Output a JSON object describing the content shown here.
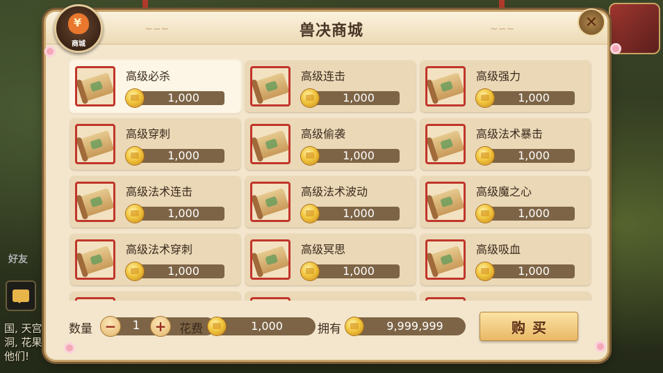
{
  "window": {
    "title": "兽决商城"
  },
  "badge": {
    "label": "商城"
  },
  "close": {
    "glyph": "✕"
  },
  "background": {
    "left_text": [
      "国, 天宫",
      "洞, 花果",
      "他们!"
    ],
    "friend_label": "好友"
  },
  "items": [
    {
      "name": "高级必杀",
      "price": "1,000",
      "selected": true
    },
    {
      "name": "高级连击",
      "price": "1,000"
    },
    {
      "name": "高级强力",
      "price": "1,000"
    },
    {
      "name": "高级穿刺",
      "price": "1,000"
    },
    {
      "name": "高级偷袭",
      "price": "1,000"
    },
    {
      "name": "高级法术暴击",
      "price": "1,000"
    },
    {
      "name": "高级法术连击",
      "price": "1,000"
    },
    {
      "name": "高级法术波动",
      "price": "1,000"
    },
    {
      "name": "高级魔之心",
      "price": "1,000"
    },
    {
      "name": "高级法术穿刺",
      "price": "1,000"
    },
    {
      "name": "高级冥思",
      "price": "1,000"
    },
    {
      "name": "高级吸血",
      "price": "1,000"
    }
  ],
  "footer": {
    "qty_label": "数量",
    "minus": "−",
    "plus": "+",
    "qty_value": "1",
    "cost_label": "花费",
    "cost_value": "1,000",
    "own_label": "拥有",
    "own_value": "9,999,999",
    "buy_label": "购买"
  },
  "colors": {
    "accent_red": "#c0352a",
    "price_bar": "#7d6446",
    "panel": "#f3e6cd"
  },
  "icons": [
    "skill-scroll-icon",
    "gold-coin-icon",
    "shop-bag-icon",
    "close-icon",
    "chat-icon"
  ]
}
